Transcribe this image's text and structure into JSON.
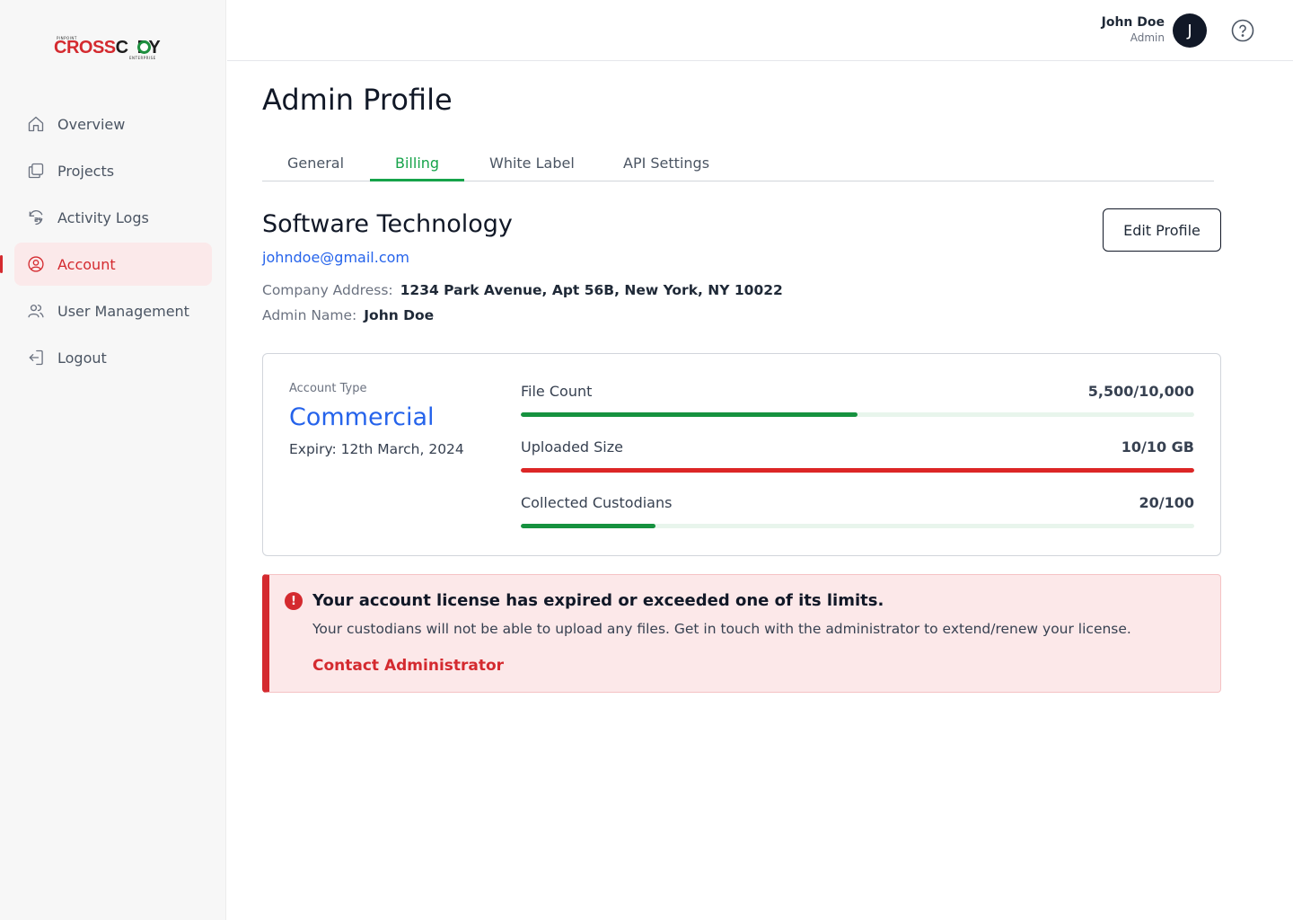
{
  "brand": {
    "prefix": "PINPOINT",
    "name_part1": "CROSS",
    "name_part2": "C",
    "name_part3": "PY",
    "suffix": "ENTERPRISE"
  },
  "sidebar": {
    "items": [
      {
        "label": "Overview",
        "icon": "home-icon",
        "active": false
      },
      {
        "label": "Projects",
        "icon": "folders-icon",
        "active": false
      },
      {
        "label": "Activity Logs",
        "icon": "history-24-icon",
        "active": false
      },
      {
        "label": "Account",
        "icon": "user-circle-icon",
        "active": true
      },
      {
        "label": "User Management",
        "icon": "users-icon",
        "active": false
      },
      {
        "label": "Logout",
        "icon": "logout-icon",
        "active": false
      }
    ]
  },
  "header": {
    "user_name": "John Doe",
    "user_role": "Admin",
    "avatar_initial": "J",
    "help_icon": "help-circle-icon"
  },
  "page": {
    "title": "Admin Profile",
    "tabs": [
      {
        "label": "General",
        "active": false
      },
      {
        "label": "Billing",
        "active": true
      },
      {
        "label": "White Label",
        "active": false
      },
      {
        "label": "API Settings",
        "active": false
      }
    ],
    "edit_button": "Edit Profile"
  },
  "profile": {
    "company_name": "Software Technology",
    "email": "johndoe@gmail.com",
    "address_label": "Company Address:",
    "address_value": "1234 Park Avenue, Apt 56B, New York, NY 10022",
    "admin_label": "Admin Name:",
    "admin_value": "John Doe"
  },
  "billing": {
    "account_type_label": "Account Type",
    "account_type_value": "Commercial",
    "expiry": "Expiry: 12th March, 2024",
    "metrics": [
      {
        "label": "File Count",
        "value": "5,500/10,000",
        "fraction": 0.5,
        "status": "ok"
      },
      {
        "label": "Uploaded Size",
        "value": "10/10 GB",
        "fraction": 1.0,
        "status": "exceeded"
      },
      {
        "label": "Collected Custodians",
        "value": "20/100",
        "fraction": 0.2,
        "status": "ok"
      }
    ]
  },
  "alert": {
    "icon": "alert-circle-icon",
    "title": "Your account license has expired or exceeded one of its limits.",
    "message": "Your custodians will not be able to upload any files. Get in touch with the administrator to extend/renew your license.",
    "link": "Contact Administrator"
  },
  "colors": {
    "brand_red": "#d42a2f",
    "accent_green": "#16a34a",
    "link_blue": "#2563eb"
  }
}
